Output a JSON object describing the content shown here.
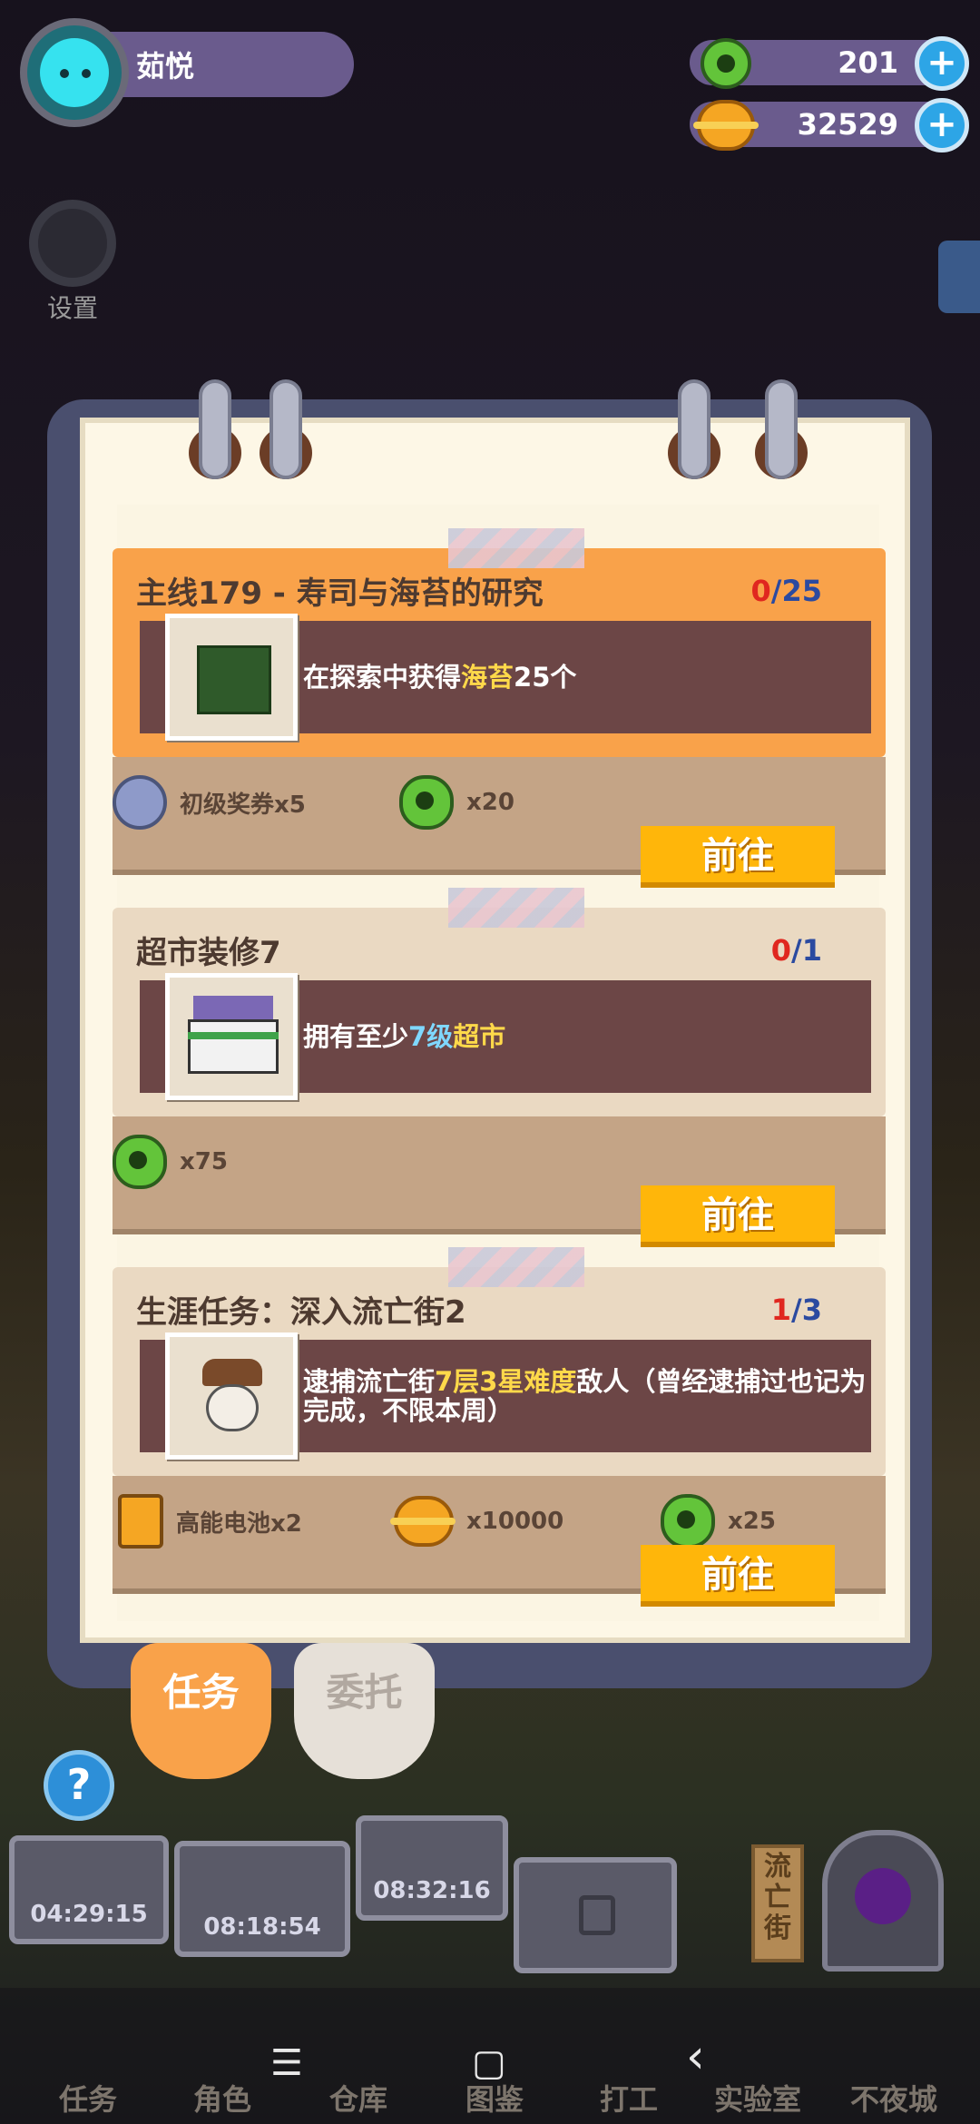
{
  "player": {
    "name": "茹悦"
  },
  "currency": {
    "donut": "201",
    "coin": "32529",
    "plus": "+"
  },
  "sidebar": {
    "settings_label": "设置"
  },
  "tasks": [
    {
      "title": "主线179 - 寿司与海苔的研究",
      "progress_current": "0",
      "progress_total": "/25",
      "desc_pre": "在探索中获得",
      "desc_hl": "海苔",
      "desc_post": "25个",
      "rewards": [
        {
          "icon": "ticket-icon",
          "text": "初级奖券x5"
        },
        {
          "icon": "donut-icon",
          "text": "x20"
        }
      ],
      "button": "前往"
    },
    {
      "title": "超市装修7",
      "progress_current": "0",
      "progress_total": "/1",
      "desc_pre": "拥有至少",
      "desc_hl_cyan": "7级",
      "desc_hl": "超市",
      "rewards": [
        {
          "icon": "donut-icon",
          "text": "x75"
        }
      ],
      "button": "前往"
    },
    {
      "title": "生涯任务：深入流亡街2",
      "progress_current": "1",
      "progress_total": "/3",
      "desc_pre": "逮捕流亡街",
      "desc_hl": "7层3星难度",
      "desc_post": "敌人（曾经逮捕过也记为完成，不限本周）",
      "rewards": [
        {
          "icon": "battery-icon",
          "text": "高能电池x2"
        },
        {
          "icon": "coin-icon",
          "text": "x10000"
        },
        {
          "icon": "donut-icon",
          "text": "x25"
        }
      ],
      "button": "前往"
    }
  ],
  "tabs": {
    "tasks": "任务",
    "commission": "委托"
  },
  "help": "?",
  "machines": [
    "04:29:15",
    "08:18:54",
    "08:32:16"
  ],
  "street_sign": "流亡街",
  "bottom_nav": [
    "任务",
    "角色",
    "仓库",
    "图鉴",
    "打工",
    "实验室",
    "不夜城"
  ],
  "system_nav": {
    "menu": "☰",
    "home": "▢",
    "back": "‹"
  },
  "colors": {
    "accent_orange": "#f9a24a",
    "button_yellow": "#ffb60a",
    "panel_purple": "#6a5b8d"
  }
}
